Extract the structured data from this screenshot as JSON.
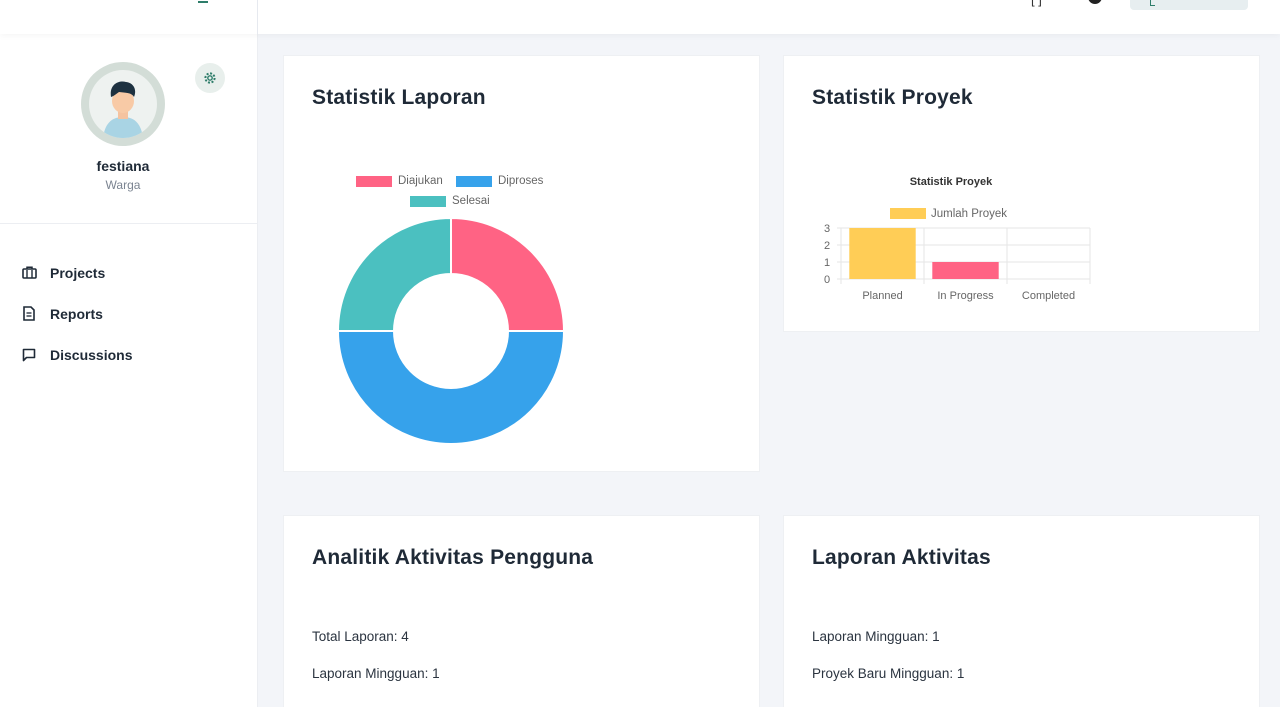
{
  "sidebar": {
    "user_name": "festiana",
    "user_role": "Warga",
    "nav": [
      {
        "label": "Projects",
        "icon": "briefcase-icon"
      },
      {
        "label": "Reports",
        "icon": "document-icon"
      },
      {
        "label": "Discussions",
        "icon": "chat-icon"
      }
    ]
  },
  "cards": {
    "laporan_title": "Statistik Laporan",
    "proyek_title": "Statistik Proyek",
    "analitik_title": "Analitik Aktivitas Pengguna",
    "aktivitas_title": "Laporan Aktivitas"
  },
  "analitik": {
    "total_laporan": "Total Laporan: 4",
    "laporan_mingguan": "Laporan Mingguan: 1"
  },
  "aktivitas": {
    "laporan_mingguan": "Laporan Mingguan: 1",
    "proyek_baru": "Proyek Baru Mingguan: 1"
  },
  "colors": {
    "accent": "#2e7d6a",
    "pink": "#ff6384",
    "blue": "#36a2eb",
    "teal": "#4bc0c0",
    "yellow": "#ffcd56"
  },
  "chart_data": [
    {
      "type": "pie",
      "variant": "doughnut",
      "labels": [
        "Diajukan",
        "Diproses",
        "Selesai"
      ],
      "values": [
        1,
        2,
        1
      ],
      "colors": [
        "#ff6384",
        "#36a2eb",
        "#4bc0c0"
      ],
      "legend": "top"
    },
    {
      "type": "bar",
      "title": "Statistik Proyek",
      "categories": [
        "Planned",
        "In Progress",
        "Completed"
      ],
      "series": [
        {
          "name": "Jumlah Proyek",
          "values": [
            3,
            1,
            0
          ]
        }
      ],
      "colors": [
        "#ffcd56",
        "#ff6384",
        "#ffcd56"
      ],
      "ylim": [
        0,
        3
      ],
      "yticks": [
        "3",
        "2",
        "1",
        "0"
      ],
      "legend": "top",
      "grid": true
    }
  ]
}
